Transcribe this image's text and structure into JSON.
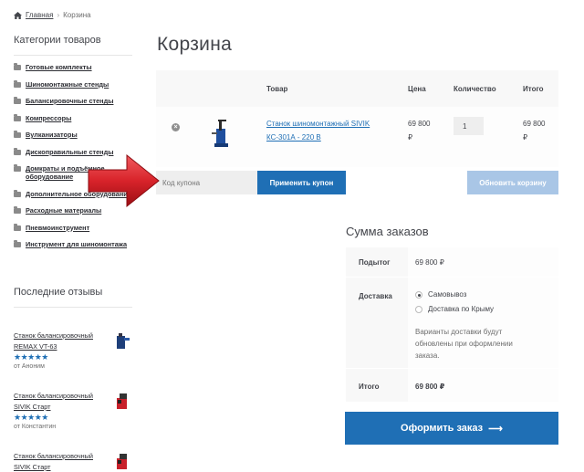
{
  "breadcrumb": {
    "home": "Главная",
    "separator": "›",
    "current": "Корзина"
  },
  "sidebar": {
    "categories_title": "Категории товаров",
    "categories": [
      "Готовые комплекты",
      "Шиномонтажные стенды",
      "Балансировочные стенды",
      "Компрессоры",
      "Вулканизаторы",
      "Дископравильные стенды",
      "Домкраты и подъёмное оборудование",
      "Дополнительное оборудование",
      "Расходные материалы",
      "Пневмоинструмент",
      "Инструмент для шиномонтажа"
    ],
    "reviews_title": "Последние отзывы",
    "reviews": [
      {
        "product": "Станок балансировочный REMAX VT-63",
        "stars": "★★★★★",
        "author": "от Аноним"
      },
      {
        "product": "Станок балансировочный SIVIK Старт",
        "stars": "★★★★★",
        "author": "от Константин"
      },
      {
        "product": "Станок балансировочный SIVIK Старт",
        "stars": "",
        "author": ""
      }
    ]
  },
  "page": {
    "title": "Корзина"
  },
  "cart": {
    "headers": {
      "product": "Товар",
      "price": "Цена",
      "quantity": "Количество",
      "total": "Итого"
    },
    "items": [
      {
        "remove": "×",
        "name": "Станок шиномонтажный SIVIK КС-301А - 220 В",
        "price": "69 800 ₽",
        "quantity": "1",
        "total": "69 800 ₽"
      }
    ],
    "coupon_placeholder": "Код купона",
    "apply_label": "Применить купон",
    "update_label": "Обновить корзину"
  },
  "totals": {
    "title": "Сумма заказов",
    "subtotal_label": "Подытог",
    "subtotal_value": "69 800 ₽",
    "shipping_label": "Доставка",
    "shipping_options": [
      "Самовывоз",
      "Доставка по Крыму"
    ],
    "shipping_selected": 0,
    "shipping_note": "Варианты доставки будут обновлены при оформлении заказа.",
    "total_label": "Итого",
    "total_value": "69 800 ₽",
    "checkout_label": "Оформить заказ",
    "checkout_arrow": "⟶"
  },
  "colors": {
    "accent": "#1f6fb5",
    "accent_disabled": "#a9c6e6",
    "arrow": "#d8232a"
  }
}
